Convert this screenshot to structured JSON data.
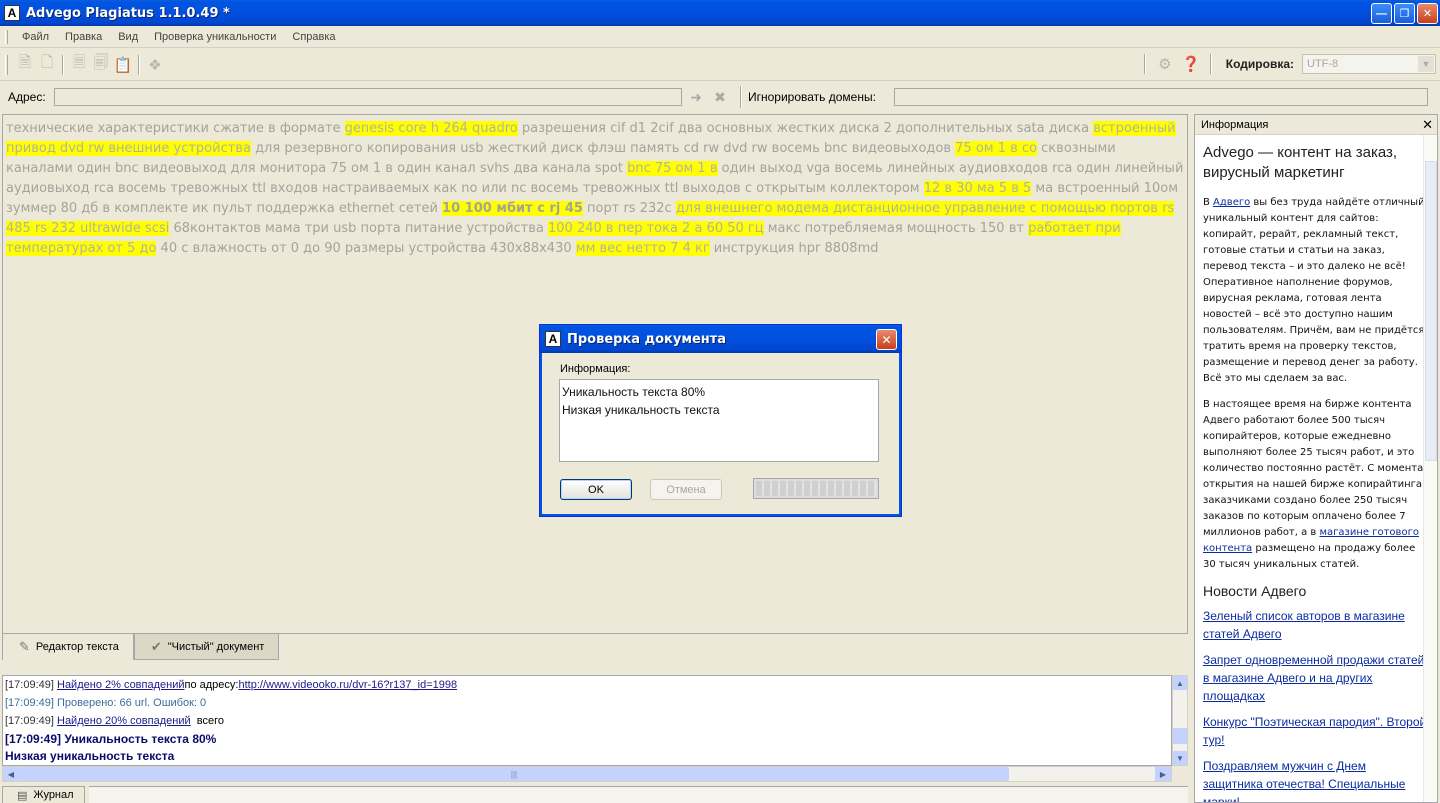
{
  "window": {
    "title": "Advego Plagiatus 1.1.0.49 *",
    "app_letter": "A"
  },
  "menu": [
    "Файл",
    "Правка",
    "Вид",
    "Проверка уникальности",
    "Справка"
  ],
  "toolbar": {
    "encoding_label": "Кодировка:",
    "encoding_value": "UTF-8"
  },
  "address": {
    "label": "Адрес:",
    "ignore_label": "Игнорировать домены:"
  },
  "editor": {
    "segments": [
      {
        "t": "технические характеристики сжатие в формате ",
        "h": 0
      },
      {
        "t": "genesis core h 264 quadro",
        "h": 1
      },
      {
        "t": " разрешения cif d1 2cif два основных жестких диска 2 дополнительных sata диска ",
        "h": 0
      },
      {
        "t": "встроенный привод dvd rw внешние устройства",
        "h": 1
      },
      {
        "t": " для резервного копирования usb жесткий диск флэш память cd rw dvd rw восемь bnc видеовыходов ",
        "h": 0
      },
      {
        "t": "75 ом 1 в со",
        "h": 1
      },
      {
        "t": " сквозными каналами один bnc видеовыход для монитора 75 ом 1 в один канал svhs два канала spot ",
        "h": 0
      },
      {
        "t": "bnc 75 ом 1 в",
        "h": 1
      },
      {
        "t": " один выход vga восемь линейных аудиовходов rca один линейный аудиовыход rca восемь тревожных ttl входов настраиваемых как no или nc восемь тревожных ttl выходов с открытым коллектором ",
        "h": 0
      },
      {
        "t": "12 в 30 ма 5 в 5",
        "h": 1
      },
      {
        "t": " ма встроенный 10ом зуммер 80 дб в комплекте ик пульт поддержка ethernet сетей ",
        "h": 0
      },
      {
        "t": "10 100 мбит с rj 45",
        "h": 2
      },
      {
        "t": " порт rs 232c ",
        "h": 0
      },
      {
        "t": "для внешнего модема дистанционное управление с помощью портов rs 485 rs 232 ultrawide scsi",
        "h": 1
      },
      {
        "t": " 68контактов мама три usb порта питание устройства ",
        "h": 0
      },
      {
        "t": "100 240 в пер тока 2 а 60 50 гц",
        "h": 1
      },
      {
        "t": " макс потребляемая мощность 150 вт ",
        "h": 0
      },
      {
        "t": "работает при температурах от 5 до",
        "h": 1
      },
      {
        "t": " 40 с влажность от 0 до 90 размеры устройства 430х88х430 ",
        "h": 0
      },
      {
        "t": "мм вес нетто 7 4 кг",
        "h": 1
      },
      {
        "t": " инструкция hpr 8808md",
        "h": 0
      }
    ]
  },
  "editor_tabs": [
    "Редактор текста",
    "\"Чистый\" документ"
  ],
  "log": {
    "l1_time": "[17:09:49]",
    "l1_link": "Найдено 2% совпадений",
    "l1_mid": " по адресу: ",
    "l1_url": "http://www.videooko.ru/dvr-16?r137_id=1998",
    "l2": "[17:09:49] Проверено: 66 url. Ошибок: 0",
    "l3_time": "[17:09:49]",
    "l3_link": "Найдено 20% совпадений",
    "l3_tail": "всего",
    "l4": "[17:09:49] Уникальность текста 80%",
    "l5": "Низкая уникальность текста"
  },
  "bottom_tabs": [
    "Журнал"
  ],
  "info": {
    "header": "Информация",
    "heading": "Advego — контент на заказ, вирусный маркетинг",
    "p1_pre": "В ",
    "p1_link": "Адвего",
    "p1_post": " вы без труда найдёте отличный уникальный контент для сайтов: копирайт, рерайт, рекламный текст, готовые статьи и статьи на заказ, перевод текста – и это далеко не всё! Оперативное наполнение форумов, вирусная реклама, готовая лента новостей – всё это доступно нашим пользователям. Причём, вам не придётся тратить время на проверку текстов, размещение и перевод денег за работу. Всё это мы сделаем за вас.",
    "p2_pre": "В настоящее время на бирже контента Адвего работают более 500 тысяч копирайтеров, которые ежедневно выполняют более 25 тысяч работ, и это количество постоянно растёт. С момента открытия на нашей бирже копирайтинга заказчиками создано более 250 тысяч заказов по которым оплачено более 7 миллионов работ, а в ",
    "p2_link": "магазине готового контента",
    "p2_post": " размещено на продажу более 30 тысяч уникальных статей.",
    "news_heading": "Новости Адвего",
    "news": [
      "Зеленый список авторов в магазине статей Адвего",
      "Запрет одновременной продажи статей в магазине Адвего и на других площадках",
      "Конкурс \"Поэтическая пародия\". Второй тур!",
      "Поздравляем мужчин с Днем защитника отечества! Специальные марки!"
    ]
  },
  "dialog": {
    "title": "Проверка документа",
    "label": "Информация:",
    "line1": "Уникальность текста 80%",
    "line2": "Низкая уникальность текста",
    "ok": "OK",
    "cancel": "Отмена"
  }
}
